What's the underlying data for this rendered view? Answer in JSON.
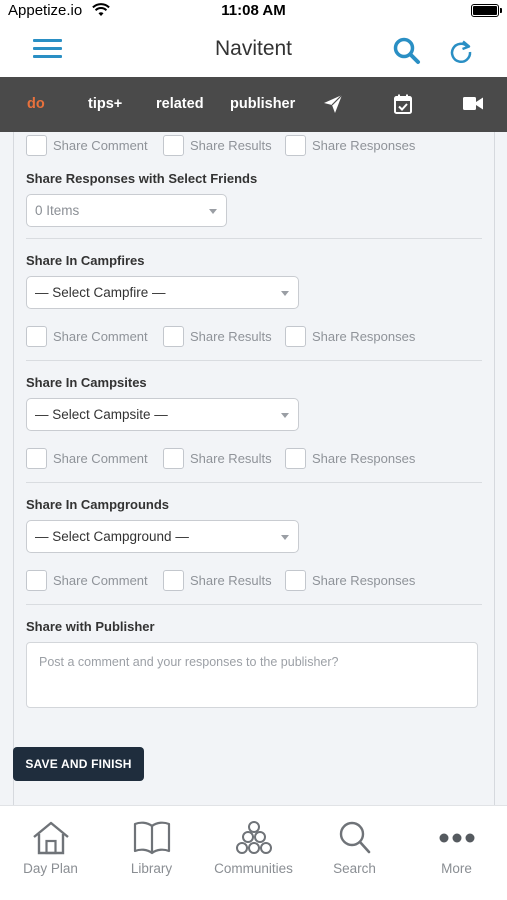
{
  "status_bar": {
    "carrier": "Appetize.io",
    "time": "11:08 AM"
  },
  "header": {
    "title": "Navitent"
  },
  "tabs": [
    {
      "label": "do",
      "active": true
    },
    {
      "label": "tips+",
      "active": false
    },
    {
      "label": "related",
      "active": false
    },
    {
      "label": "publisher",
      "active": false
    }
  ],
  "tab_icons": [
    "send-icon",
    "calendar-check-icon",
    "video-camera-icon"
  ],
  "checkbox_labels": {
    "comment": "Share Comment",
    "results": "Share Results",
    "responses": "Share Responses"
  },
  "friends": {
    "label": "Share Responses with Select Friends",
    "value": "0 Items"
  },
  "campfires": {
    "label": "Share In Campfires",
    "select": "— Select Campfire —"
  },
  "campsites": {
    "label": "Share In Campsites",
    "select": "— Select Campsite —"
  },
  "campgrounds": {
    "label": "Share In Campgrounds",
    "select": "— Select Campground —"
  },
  "publisher": {
    "label": "Share with Publisher",
    "placeholder": "Post a comment and your responses to the publisher?"
  },
  "save_button": "SAVE AND FINISH",
  "bottom_nav": [
    {
      "label": "Day Plan",
      "icon": "home-icon"
    },
    {
      "label": "Library",
      "icon": "book-icon"
    },
    {
      "label": "Communities",
      "icon": "communities-icon"
    },
    {
      "label": "Search",
      "icon": "search-icon"
    },
    {
      "label": "More",
      "icon": "more-icon"
    }
  ],
  "colors": {
    "accent": "#2a8fc4",
    "tab_bar": "#4a4a4a",
    "active_tab": "#e8713c",
    "button": "#1f2d3d"
  }
}
